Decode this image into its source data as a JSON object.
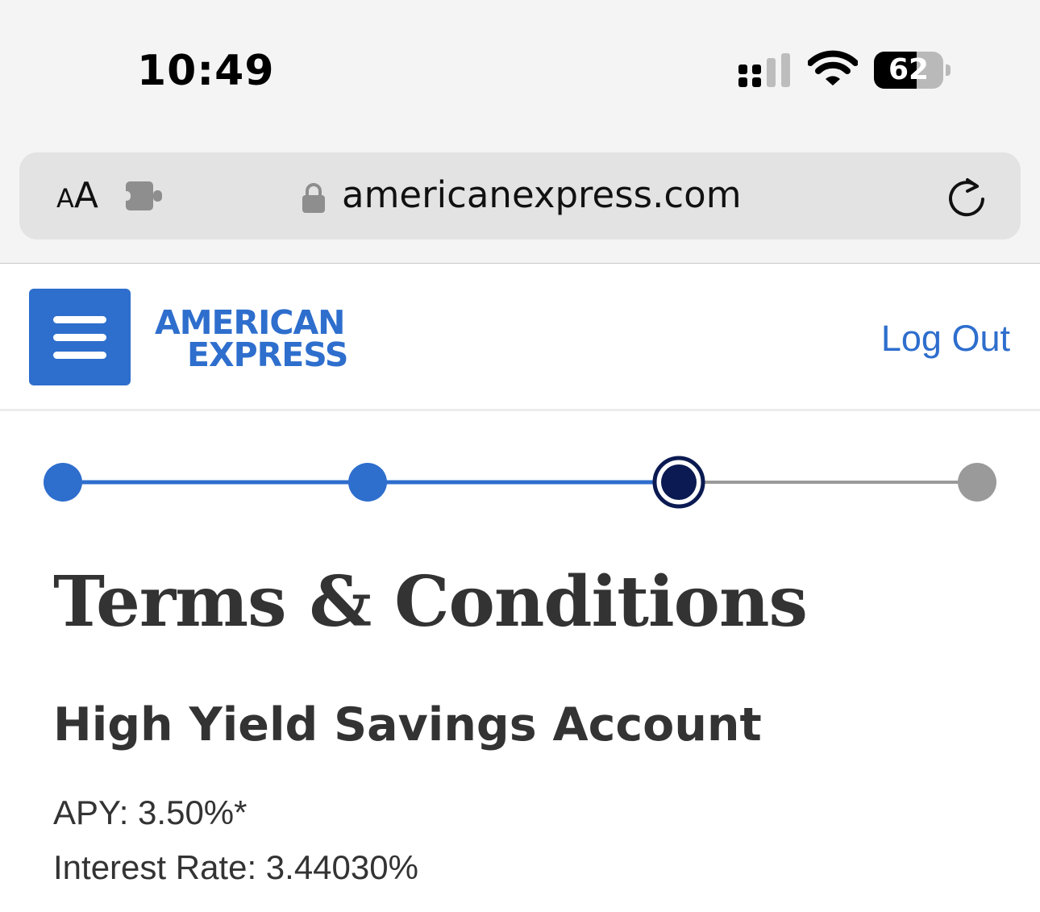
{
  "status_bar": {
    "time": "10:49",
    "battery_percent": 62,
    "battery_label": "62",
    "icons": [
      "cellular-signal-icon",
      "wifi-icon",
      "battery-icon"
    ]
  },
  "browser": {
    "text_size_label_small": "A",
    "text_size_label_large": "A",
    "url": "americanexpress.com",
    "icons": [
      "extension-icon",
      "lock-icon",
      "reload-icon"
    ]
  },
  "header": {
    "logo_line1": "AMERICAN",
    "logo_line2": "EXPRESS",
    "logout_label": "Log Out",
    "menu_icon": "hamburger-menu-icon"
  },
  "progress": {
    "total_steps": 4,
    "current_step": 3,
    "colors": {
      "completed": "#2e6ecd",
      "current": "#0b1a52",
      "upcoming": "#9a9a9a"
    }
  },
  "content": {
    "title": "Terms & Conditions",
    "product_name": "High Yield Savings Account",
    "apy_line": "APY: 3.50%*",
    "interest_line": "Interest Rate: 3.44030%"
  },
  "colors": {
    "brand_blue": "#2e6ecd",
    "text": "#333333"
  }
}
